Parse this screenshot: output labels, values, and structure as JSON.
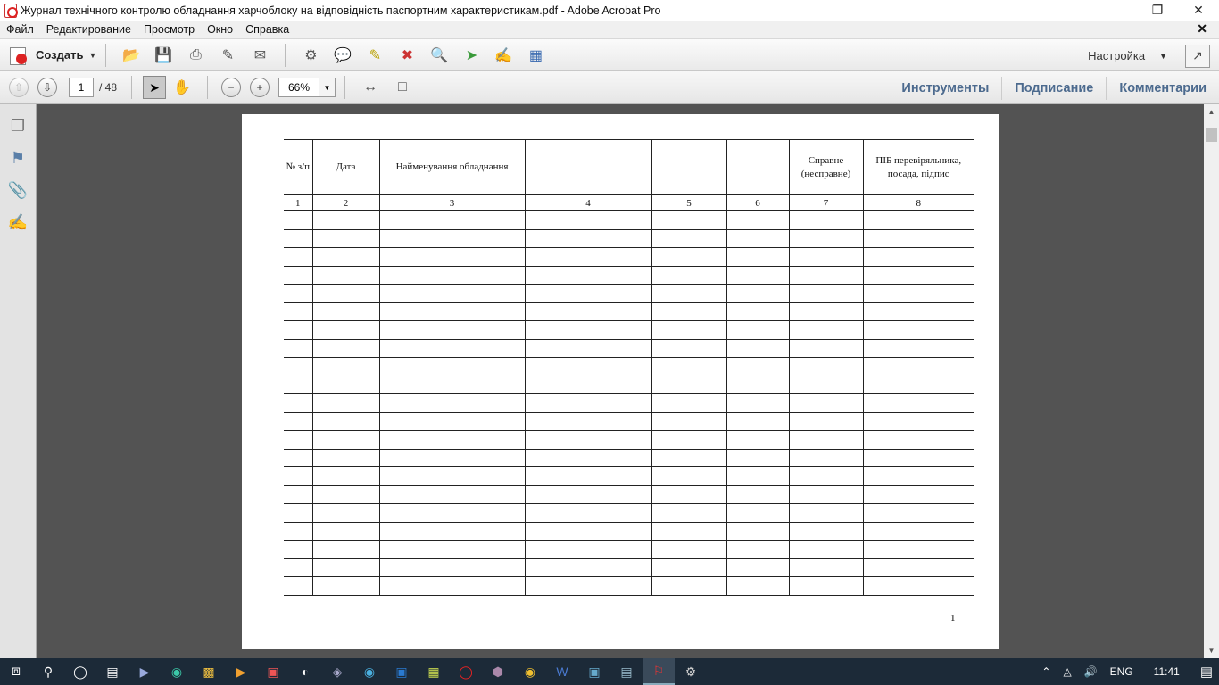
{
  "window": {
    "title": "Журнал технічного контролю обладнання харчоблоку на відповідність паспортним характеристикам.pdf - Adobe Acrobat Pro",
    "minimize_icon": "minimize-icon",
    "restore_icon": "restore-icon",
    "close_icon": "close-icon"
  },
  "menu": {
    "items": [
      "Файл",
      "Редактирование",
      "Просмотр",
      "Окно",
      "Справка"
    ]
  },
  "toolbar": {
    "create_label": "Создать",
    "setup_label": "Настройка"
  },
  "nav": {
    "page_current": "1",
    "page_total": "/ 48",
    "zoom": "66%"
  },
  "panels": {
    "tools": "Инструменты",
    "sign": "Подписание",
    "comments": "Комментарии"
  },
  "document": {
    "headers": [
      "№ з/п",
      "Дата",
      "Найменування обладнання",
      "",
      "",
      "",
      "Справне (несправне)",
      "ПІБ перевіряльника, посада, підпис"
    ],
    "faded_headers": [
      "",
      "",
      "",
      "",
      "",
      "",
      "",
      ""
    ],
    "column_numbers": [
      "1",
      "2",
      "3",
      "4",
      "5",
      "6",
      "7",
      "8"
    ],
    "empty_rows": 21,
    "page_number": "1"
  },
  "taskbar": {
    "lang": "ENG",
    "time": "11:41"
  }
}
